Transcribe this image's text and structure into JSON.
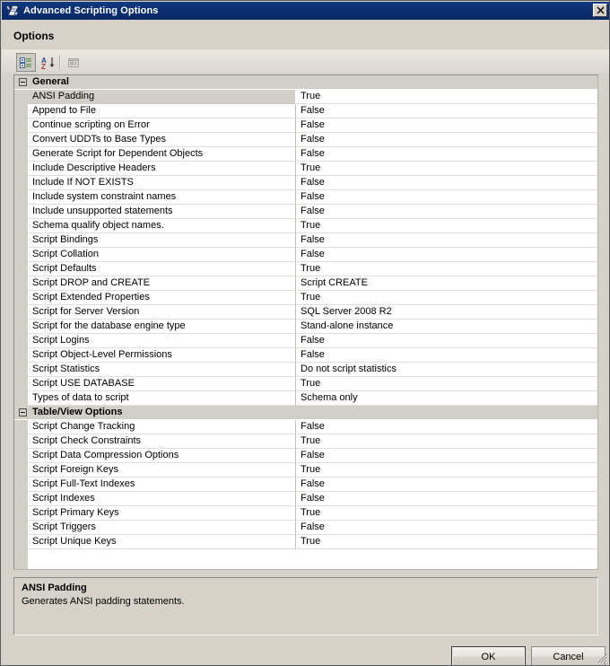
{
  "window": {
    "title": "Advanced Scripting Options",
    "title_icon": "script-scroll-icon",
    "close_label": "✕"
  },
  "header": {
    "options_label": "Options"
  },
  "toolbar": {
    "buttons": [
      {
        "name": "categorized-view-button",
        "tooltip": "Categorized",
        "pressed": true
      },
      {
        "name": "alphabetical-sort-button",
        "tooltip": "Alphabetical",
        "pressed": false
      },
      {
        "name": "property-pages-button",
        "tooltip": "Property Pages",
        "pressed": false,
        "disabled": true
      }
    ]
  },
  "grid": {
    "categories": [
      {
        "name": "General",
        "expanded": true,
        "rows": [
          {
            "name": "ANSI Padding",
            "value": "True",
            "selected": true
          },
          {
            "name": "Append to File",
            "value": "False",
            "selected": false
          },
          {
            "name": "Continue scripting on Error",
            "value": "False",
            "selected": false
          },
          {
            "name": "Convert UDDTs to Base Types",
            "value": "False",
            "selected": false
          },
          {
            "name": "Generate Script for Dependent Objects",
            "value": "False",
            "selected": false
          },
          {
            "name": "Include Descriptive Headers",
            "value": "True",
            "selected": false
          },
          {
            "name": "Include If NOT EXISTS",
            "value": "False",
            "selected": false
          },
          {
            "name": "Include system constraint names",
            "value": "False",
            "selected": false
          },
          {
            "name": "Include unsupported statements",
            "value": "False",
            "selected": false
          },
          {
            "name": "Schema qualify object names.",
            "value": "True",
            "selected": false
          },
          {
            "name": "Script Bindings",
            "value": "False",
            "selected": false
          },
          {
            "name": "Script Collation",
            "value": "False",
            "selected": false
          },
          {
            "name": "Script Defaults",
            "value": "True",
            "selected": false
          },
          {
            "name": "Script DROP and CREATE",
            "value": "Script CREATE",
            "selected": false
          },
          {
            "name": "Script Extended Properties",
            "value": "True",
            "selected": false
          },
          {
            "name": "Script for Server Version",
            "value": "SQL Server 2008 R2",
            "selected": false
          },
          {
            "name": "Script for the database engine type",
            "value": "Stand-alone instance",
            "selected": false
          },
          {
            "name": "Script Logins",
            "value": "False",
            "selected": false
          },
          {
            "name": "Script Object-Level Permissions",
            "value": "False",
            "selected": false
          },
          {
            "name": "Script Statistics",
            "value": "Do not script statistics",
            "selected": false
          },
          {
            "name": "Script USE DATABASE",
            "value": "True",
            "selected": false
          },
          {
            "name": "Types of data to script",
            "value": "Schema only",
            "selected": false
          }
        ]
      },
      {
        "name": "Table/View Options",
        "expanded": true,
        "rows": [
          {
            "name": "Script Change Tracking",
            "value": "False",
            "selected": false
          },
          {
            "name": "Script Check Constraints",
            "value": "True",
            "selected": false
          },
          {
            "name": "Script Data Compression Options",
            "value": "False",
            "selected": false
          },
          {
            "name": "Script Foreign Keys",
            "value": "True",
            "selected": false
          },
          {
            "name": "Script Full-Text Indexes",
            "value": "False",
            "selected": false
          },
          {
            "name": "Script Indexes",
            "value": "False",
            "selected": false
          },
          {
            "name": "Script Primary Keys",
            "value": "True",
            "selected": false
          },
          {
            "name": "Script Triggers",
            "value": "False",
            "selected": false
          },
          {
            "name": "Script Unique Keys",
            "value": "True",
            "selected": false
          }
        ]
      }
    ]
  },
  "description": {
    "title": "ANSI Padding",
    "text": "Generates ANSI padding statements."
  },
  "footer": {
    "ok_label": "OK",
    "cancel_label": "Cancel"
  },
  "colors": {
    "titlebar": "#0c2f70",
    "dialog_face": "#d6d2ca",
    "grid_background": "#ffffff",
    "category_row": "#d2cfc8"
  }
}
